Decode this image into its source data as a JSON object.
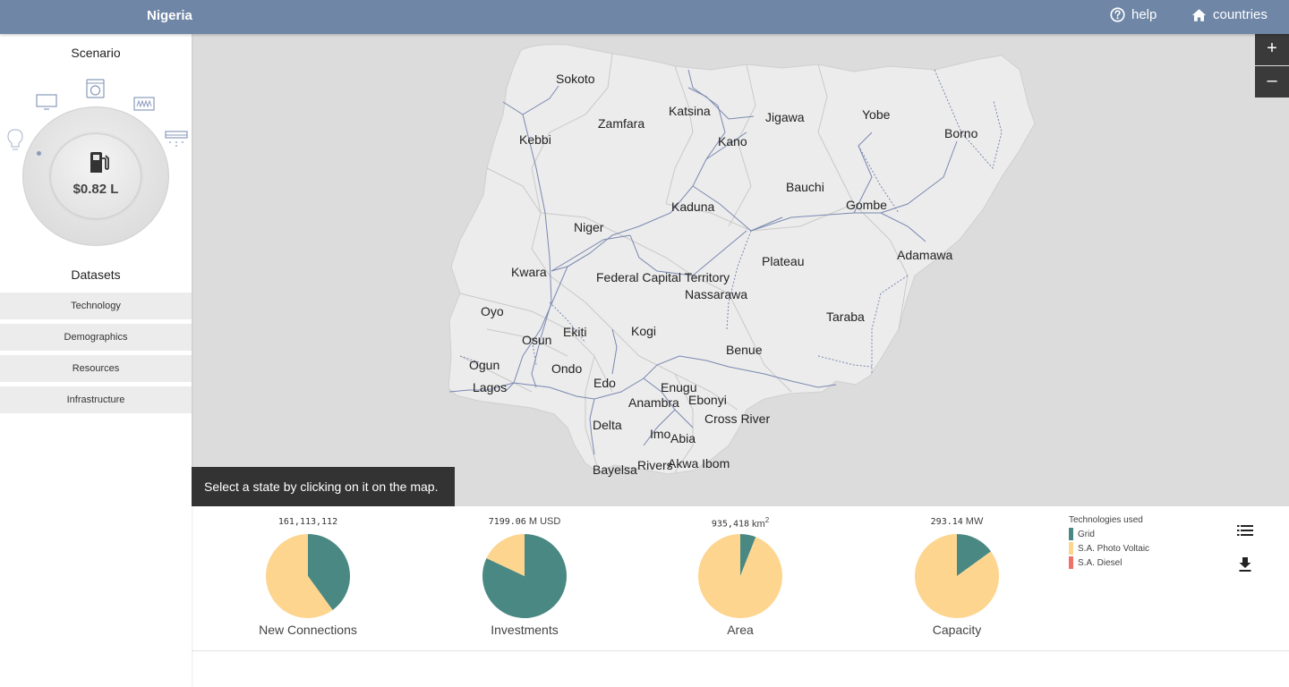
{
  "header": {
    "country": "Nigeria",
    "help_label": "help",
    "countries_label": "countries"
  },
  "sidebar": {
    "scenario_title": "Scenario",
    "scenario_value": "$0.82 L",
    "datasets_title": "Datasets",
    "datasets": [
      "Technology",
      "Demographics",
      "Resources",
      "Infrastructure"
    ]
  },
  "map": {
    "states": [
      "Sokoto",
      "Katsina",
      "Zamfara",
      "Jigawa",
      "Yobe",
      "Kebbi",
      "Kano",
      "Borno",
      "Bauchi",
      "Kaduna",
      "Gombe",
      "Niger",
      "Plateau",
      "Adamawa",
      "Kwara",
      "Federal Capital Territory",
      "Nassarawa",
      "Oyo",
      "Taraba",
      "Ekiti",
      "Kogi",
      "Osun",
      "Benue",
      "Ogun",
      "Ondo",
      "Lagos",
      "Edo",
      "Enugu",
      "Ebonyi",
      "Anambra",
      "Cross River",
      "Delta",
      "Imo",
      "Abia",
      "Bayelsa",
      "Rivers",
      "Akwa Ibom"
    ],
    "zoom_in": "+",
    "zoom_out": "–",
    "hint": "Select a state by clicking on it on the map."
  },
  "stats": [
    {
      "value": "161,113,112",
      "unit": "",
      "label": "New Connections",
      "shares": [
        0.4,
        0.6,
        0
      ]
    },
    {
      "value": "7199.06",
      "unit": "M USD",
      "label": "Investments",
      "shares": [
        0.82,
        0.18,
        0
      ]
    },
    {
      "value": "935,418",
      "unit": "km",
      "unit_sup": "2",
      "label": "Area",
      "shares": [
        0.06,
        0.94,
        0
      ]
    },
    {
      "value": "293.14",
      "unit": "MW",
      "label": "Capacity",
      "shares": [
        0.15,
        0.85,
        0
      ]
    }
  ],
  "legend": {
    "title": "Technologies used",
    "items": [
      {
        "label": "Grid",
        "color": "#4a8883"
      },
      {
        "label": "S.A. Photo Voltaic",
        "color": "#fdd58f"
      },
      {
        "label": "S.A. Diesel",
        "color": "#f0706a"
      }
    ]
  },
  "colors": {
    "header": "#6f86a6",
    "map_background": "#dcdcdc",
    "country_fill": "#ececec",
    "grid_lines": "#7a88b0"
  },
  "icons": {
    "list_icon": "list-icon",
    "download_icon": "download-icon"
  }
}
